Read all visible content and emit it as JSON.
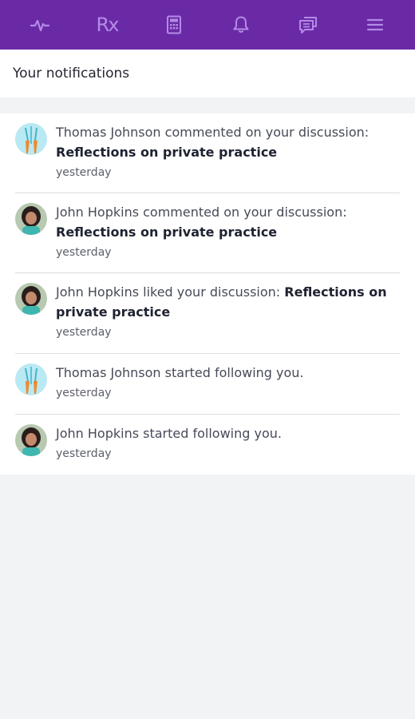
{
  "nav": {
    "items": [
      {
        "icon": "activity-pulse-icon"
      },
      {
        "icon": "prescription-icon",
        "label": "Rx"
      },
      {
        "icon": "calculator-icon"
      },
      {
        "icon": "bell-icon"
      },
      {
        "icon": "chat-bubbles-icon"
      },
      {
        "icon": "hamburger-menu-icon"
      }
    ],
    "bg_color": "#6a2aa6",
    "icon_color": "#b48ae6"
  },
  "header": {
    "title": "Your notifications"
  },
  "notifications": [
    {
      "avatar": "thomas-johnson-avatar",
      "text_plain": "Thomas Johnson commented on your discussion:",
      "text_bold": "Reflections on private practice",
      "time": "yesterday"
    },
    {
      "avatar": "john-hopkins-avatar",
      "text_plain": "John Hopkins commented on your discussion:",
      "text_bold": "Reflections on private practice",
      "time": "yesterday"
    },
    {
      "avatar": "john-hopkins-avatar",
      "text_plain": "John Hopkins liked your discussion:",
      "text_bold": "Reflections on private practice",
      "time": "yesterday"
    },
    {
      "avatar": "thomas-johnson-avatar",
      "text_plain": "Thomas Johnson started following you.",
      "text_bold": "",
      "time": "yesterday"
    },
    {
      "avatar": "john-hopkins-avatar",
      "text_plain": "John Hopkins started following you.",
      "text_bold": "",
      "time": "yesterday"
    }
  ]
}
